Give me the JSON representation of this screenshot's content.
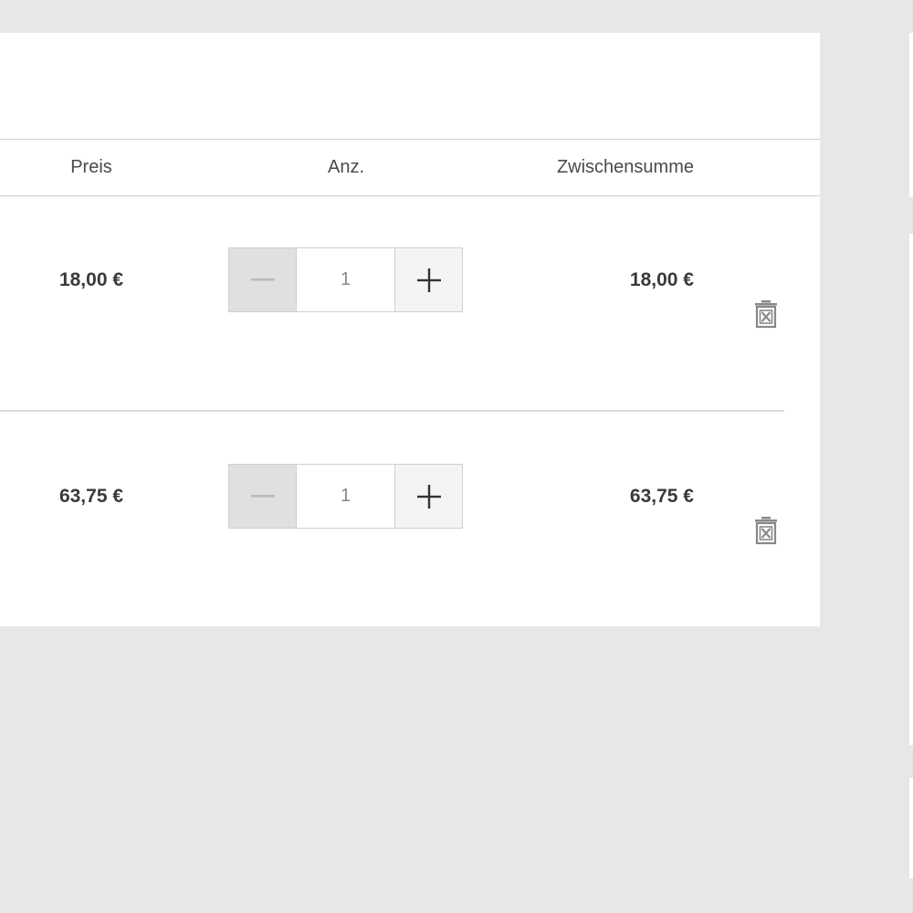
{
  "cart": {
    "columns": {
      "price": "Preis",
      "quantity": "Anz.",
      "subtotal": "Zwischensumme"
    },
    "items": [
      {
        "price": "18,00 €",
        "quantity": "1",
        "subtotal": "18,00 €"
      },
      {
        "price": "63,75 €",
        "quantity": "1",
        "subtotal": "63,75 €"
      }
    ]
  },
  "icons": {
    "decrease": "minus-icon",
    "increase": "plus-icon",
    "remove": "trash-icon"
  },
  "colors": {
    "background": "#e7e7e7",
    "panel": "#ffffff",
    "text": "#3a3a3a",
    "border": "#cfcfcf",
    "minus_button": "#e0e0e0",
    "plus_button": "#f4f4f4"
  }
}
